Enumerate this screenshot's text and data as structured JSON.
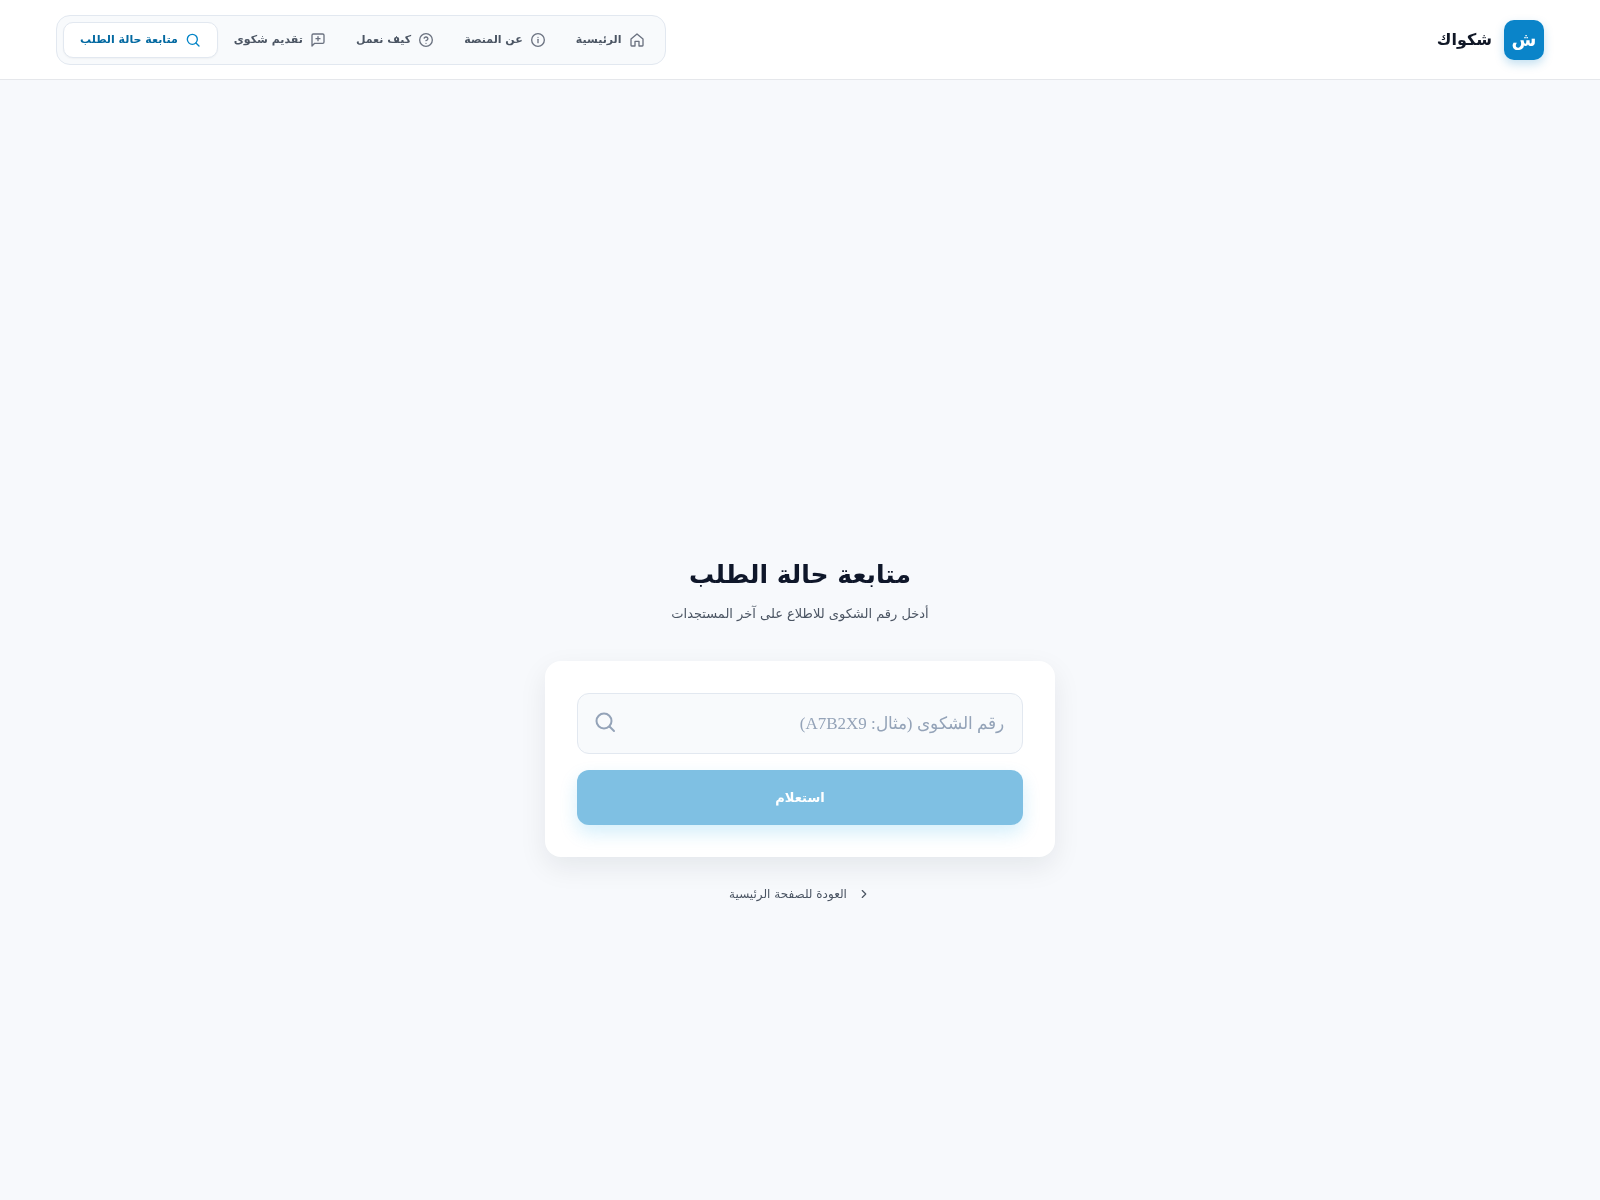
{
  "header": {
    "logo": {
      "mark": "ش",
      "name": "شكواك"
    },
    "nav": [
      {
        "label": "الرئيسية",
        "selected": false
      },
      {
        "label": "عن المنصة",
        "selected": false
      },
      {
        "label": "كيف نعمل",
        "selected": false
      },
      {
        "label": "تقديم شكوى",
        "selected": false
      },
      {
        "label": "متابعة حالة الطلب",
        "selected": true
      }
    ]
  },
  "main": {
    "title": "متابعة حالة الطلب",
    "subtitle": "أدخل رقم الشكوى للاطلاع على آخر المستجدات",
    "card": {
      "search": {
        "placeholder": "رقم الشكوى (مثال: A7B2X9)"
      },
      "button": {
        "label": "استعلام",
        "disabled": true
      }
    },
    "back_link": {
      "label": "العودة للصفحة الرئيسية"
    }
  }
}
